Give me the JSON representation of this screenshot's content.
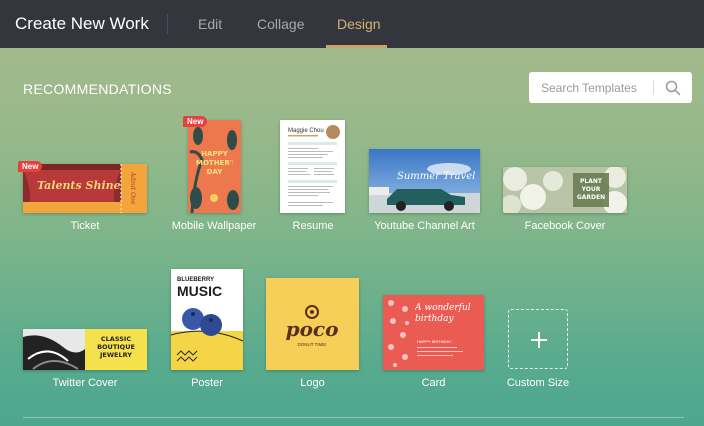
{
  "header": {
    "title": "Create New Work",
    "tabs": [
      {
        "label": "Edit",
        "active": false
      },
      {
        "label": "Collage",
        "active": false
      },
      {
        "label": "Design",
        "active": true
      }
    ]
  },
  "section": {
    "title": "RECOMMENDATIONS"
  },
  "search": {
    "placeholder": "Search Templates",
    "icon": "search-icon"
  },
  "templates": [
    {
      "label": "Ticket",
      "badge": "New",
      "thumb_text": "Talents Shine",
      "thumb_sub": "Admit One"
    },
    {
      "label": "Mobile Wallpaper",
      "badge": "New",
      "thumb_text": "HAPPY MOTHER'S DAY"
    },
    {
      "label": "Resume",
      "thumb_text": "Maggie Chou"
    },
    {
      "label": "Youtube Channel Art",
      "thumb_text": "Summer Travel"
    },
    {
      "label": "Facebook Cover",
      "thumb_text": "PLANT YOUR GARDEN"
    },
    {
      "label": "Twitter Cover",
      "thumb_text": "CLASSIC BOUTIQUE JEWELRY"
    },
    {
      "label": "Poster",
      "thumb_text": "BLUEBERRY",
      "thumb_sub": "MUSIC"
    },
    {
      "label": "Logo",
      "thumb_text": "poco",
      "thumb_sub": "DONUT TIME!"
    },
    {
      "label": "Card",
      "thumb_text": "A wonderful birthday",
      "thumb_sub": "HAPPY BIRTHDAY"
    },
    {
      "label": "Custom Size",
      "icon": "plus-icon"
    }
  ],
  "colors": {
    "topbar": "#34363e",
    "accent": "#c9a46a",
    "badge": "#e4413f"
  }
}
